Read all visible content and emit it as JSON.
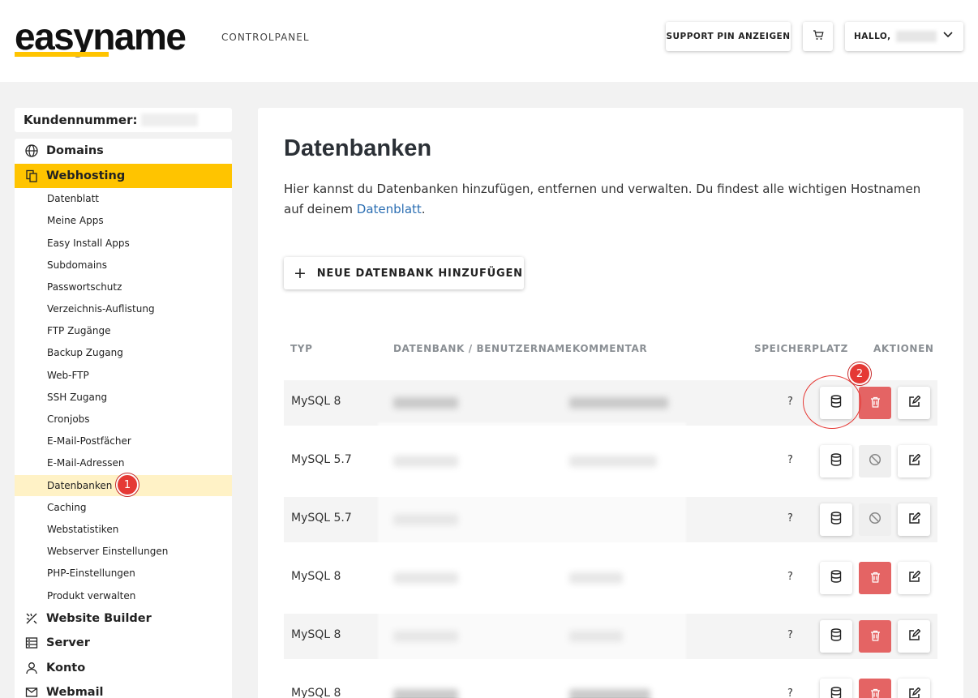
{
  "header": {
    "logo": "easyname",
    "section_label": "CONTROLPANEL",
    "support_pin_label": "SUPPORT PIN ANZEIGEN",
    "greeting": "HALLO,"
  },
  "sidebar": {
    "customer_label": "Kundennummer:",
    "main_items": [
      {
        "label": "Domains",
        "icon": "globe-icon"
      },
      {
        "label": "Webhosting",
        "icon": "copy-icon"
      },
      {
        "label": "Website Builder",
        "icon": "builder-icon"
      },
      {
        "label": "Server",
        "icon": "server-icon"
      },
      {
        "label": "Konto",
        "icon": "user-icon"
      },
      {
        "label": "Webmail",
        "icon": "mail-icon"
      }
    ],
    "sub_items": [
      "Datenblatt",
      "Meine Apps",
      "Easy Install Apps",
      "Subdomains",
      "Passwortschutz",
      "Verzeichnis-Auflistung",
      "FTP Zugänge",
      "Backup Zugang",
      "Web-FTP",
      "SSH Zugang",
      "Cronjobs",
      "E-Mail-Postfächer",
      "E-Mail-Adressen",
      "Datenbanken",
      "Caching",
      "Webstatistiken",
      "Webserver Einstellungen",
      "PHP-Einstellungen",
      "Produkt verwalten"
    ],
    "active_main": "Webhosting",
    "active_sub": "Datenbanken"
  },
  "main": {
    "title": "Datenbanken",
    "description_prefix": "Hier kannst du Datenbanken hinzufügen, entfernen und verwalten. Du findest alle wichtigen Hostnamen auf deinem ",
    "description_link": "Datenblatt",
    "description_suffix": ".",
    "add_button_label": "NEUE DATENBANK HINZUFÜGEN",
    "table": {
      "columns": [
        "TYP",
        "DATENBANK / BENUTZERNAME",
        "KOMMENTAR",
        "SPEICHERPLATZ",
        "AKTIONEN"
      ],
      "rows": [
        {
          "type": "MySQL 8",
          "storage": "?",
          "deletable": true
        },
        {
          "type": "MySQL 5.7",
          "storage": "?",
          "deletable": false
        },
        {
          "type": "MySQL 5.7",
          "storage": "?",
          "deletable": false
        },
        {
          "type": "MySQL 8",
          "storage": "?",
          "deletable": true
        },
        {
          "type": "MySQL 8",
          "storage": "?",
          "deletable": true
        },
        {
          "type": "MySQL 8",
          "storage": "?",
          "deletable": true
        }
      ]
    }
  },
  "annotations": {
    "badge_1": "1",
    "badge_2": "2"
  },
  "colors": {
    "brand_yellow": "#ffc400",
    "delete_red": "#e46464",
    "link_blue": "#2c6fb3",
    "annotation_red": "#e53935"
  }
}
